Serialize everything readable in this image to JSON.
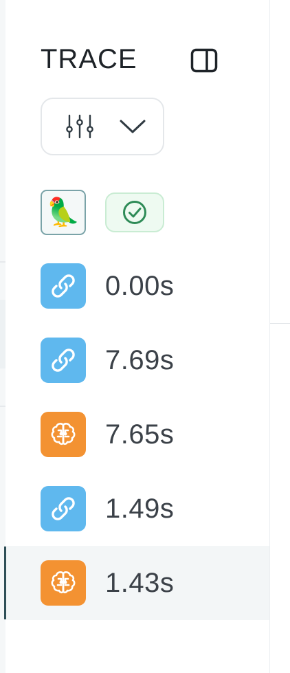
{
  "panel": {
    "title": "TRACE"
  },
  "colors": {
    "chain_icon_bg": "#5fb8ee",
    "llm_icon_bg": "#f39232",
    "status_border": "#c9ecd3",
    "status_check": "#2e8b57",
    "avatar_border": "#7aa3a8",
    "selected_row_bg": "#f3f6f7"
  },
  "avatar": {
    "icon": "parrot-icon",
    "glyph": "🦜"
  },
  "status": {
    "icon": "check-circle-icon"
  },
  "filter": {
    "icon": "sliders-icon",
    "chevron": "chevron-down-icon"
  },
  "trace_rows": [
    {
      "type": "chain",
      "icon": "link-icon",
      "duration": "0.00s",
      "selected": false
    },
    {
      "type": "chain",
      "icon": "link-icon",
      "duration": "7.69s",
      "selected": false
    },
    {
      "type": "llm",
      "icon": "brain-icon",
      "duration": "7.65s",
      "selected": false
    },
    {
      "type": "chain",
      "icon": "link-icon",
      "duration": "1.49s",
      "selected": false
    },
    {
      "type": "llm",
      "icon": "brain-icon",
      "duration": "1.43s",
      "selected": true
    }
  ]
}
